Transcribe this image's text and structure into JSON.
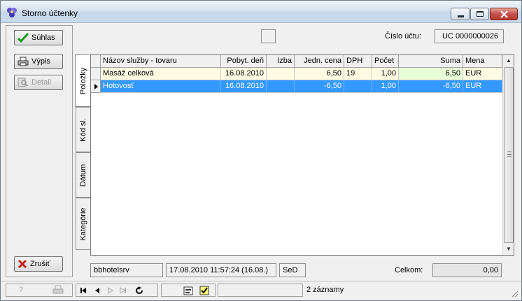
{
  "window": {
    "title": "Storno účtenky"
  },
  "buttons": {
    "agree": "Súhlas",
    "print": "Výpis",
    "detail": "Detail",
    "cancel": "Zrušiť"
  },
  "account": {
    "label": "Číslo účtu:",
    "value": "UC 0000000026"
  },
  "tabs": [
    "Položky",
    "Kód sl.",
    "Dátum",
    "Kategórie"
  ],
  "table": {
    "columns": [
      "Názov služby - tovaru",
      "Pobyt. deň",
      "Izba",
      "Jedn. cena",
      "DPH",
      "Počet",
      "Suma",
      "Mena"
    ],
    "rows": [
      [
        "Masáž celková",
        "16.08.2010",
        "",
        "6,50",
        "19",
        "1,00",
        "6,50",
        "EUR"
      ],
      [
        "Hotovosť",
        "16.08.2010",
        "",
        "-6,50",
        "",
        "1,00",
        "-6,50",
        "EUR"
      ]
    ]
  },
  "footer": {
    "server": "bbhotelsrv",
    "datetime": "17.08.2010 11:57:24 (16.08.)",
    "user": "SeD",
    "total_label": "Celkom:",
    "total_value": "0,00"
  },
  "status": {
    "records": "2 záznamy"
  },
  "colors": {
    "selected_row": "#3399ff",
    "first_row": "#fffce4",
    "close_button": "#c75050"
  }
}
